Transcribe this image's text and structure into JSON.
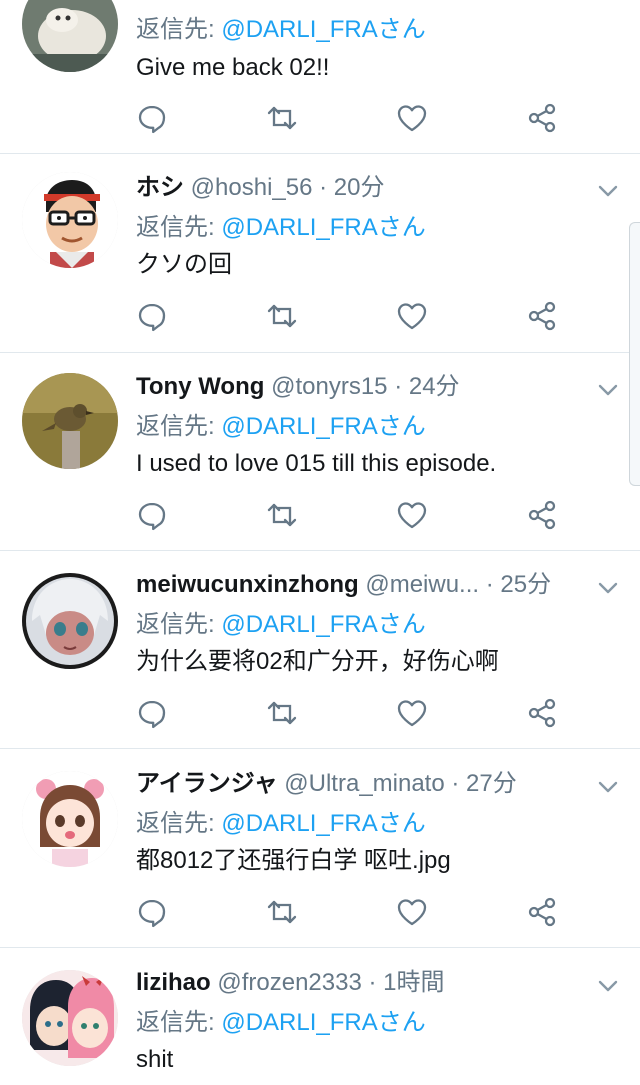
{
  "colors": {
    "accent": "#1da1f2",
    "muted": "#657786",
    "text": "#14171a",
    "divider": "#e1e8ed"
  },
  "icons": {
    "reply": "reply-icon",
    "retweet": "retweet-icon",
    "like": "heart-icon",
    "share": "share-icon",
    "caret": "chevron-down-icon"
  },
  "tweets": [
    {
      "name": "",
      "handle": "",
      "time": "",
      "reply_prefix": "返信先: ",
      "reply_to": "@DARLI_FRAさん",
      "text": "Give me back 02!!",
      "avatar": "cat-avatar"
    },
    {
      "name": "ホシ",
      "handle": "@hoshi_56",
      "sep": "·",
      "time": "20分",
      "reply_prefix": "返信先: ",
      "reply_to": "@DARLI_FRAさん",
      "text": "クソの回",
      "avatar": "glasses-man-avatar"
    },
    {
      "name": "Tony Wong",
      "handle": "@tonyrs15",
      "sep": "·",
      "time": "24分",
      "reply_prefix": "返信先: ",
      "reply_to": "@DARLI_FRAさん",
      "text": "I used to love 015 till this episode.",
      "avatar": "bird-avatar"
    },
    {
      "name": "meiwucunxinzhong",
      "handle": "@meiwu...",
      "sep": "·",
      "time": "25分",
      "reply_prefix": "返信先: ",
      "reply_to": "@DARLI_FRAさん",
      "text": "为什么要将02和广分开，好伤心啊",
      "avatar": "anime-girl-avatar"
    },
    {
      "name": "アイランジャ",
      "handle": "@Ultra_minato",
      "sep": "·",
      "time": "27分",
      "reply_prefix": "返信先: ",
      "reply_to": "@DARLI_FRAさん",
      "text": "都8012了还强行白学 呕吐.jpg",
      "avatar": "pink-bow-girl-avatar"
    },
    {
      "name": "lizihao",
      "handle": "@frozen2333",
      "sep": "·",
      "time": "1時間",
      "reply_prefix": "返信先: ",
      "reply_to": "@DARLI_FRAさん",
      "text": "shit",
      "avatar": "anime-duo-avatar"
    }
  ]
}
